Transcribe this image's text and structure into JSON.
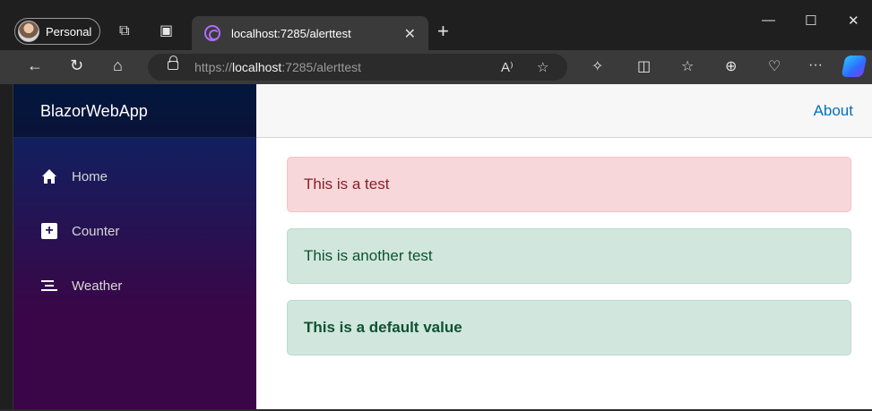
{
  "browser": {
    "profile_label": "Personal",
    "tab_title": "localhost:7285/alerttest",
    "url_scheme": "https://",
    "url_host": "localhost",
    "url_rest": ":7285/alerttest",
    "read_aloud_label": "A⁾",
    "icons": [
      "workspaces-icon",
      "tab-actions-icon",
      "back-icon",
      "refresh-icon",
      "home-icon",
      "favorite-star-icon",
      "extensions-icon",
      "split-screen-icon",
      "favorites-icon",
      "collections-icon",
      "browser-essentials-icon",
      "more-icon",
      "copilot-icon"
    ]
  },
  "app": {
    "brand": "BlazorWebApp",
    "about_link": "About",
    "nav": [
      {
        "label": "Home",
        "icon": "house-icon"
      },
      {
        "label": "Counter",
        "icon": "plus-square-icon"
      },
      {
        "label": "Weather",
        "icon": "list-icon"
      }
    ],
    "alerts": [
      {
        "text": "This is a test",
        "kind": "danger"
      },
      {
        "text": "This is another test",
        "kind": "success"
      },
      {
        "text": "This is a default value",
        "kind": "success"
      }
    ]
  },
  "colors": {
    "sidebar_top": "#052767",
    "sidebar_bottom": "#3a0647",
    "link": "#0071c1",
    "danger_bg": "#f8d7da",
    "success_bg": "#d1e7dd"
  }
}
